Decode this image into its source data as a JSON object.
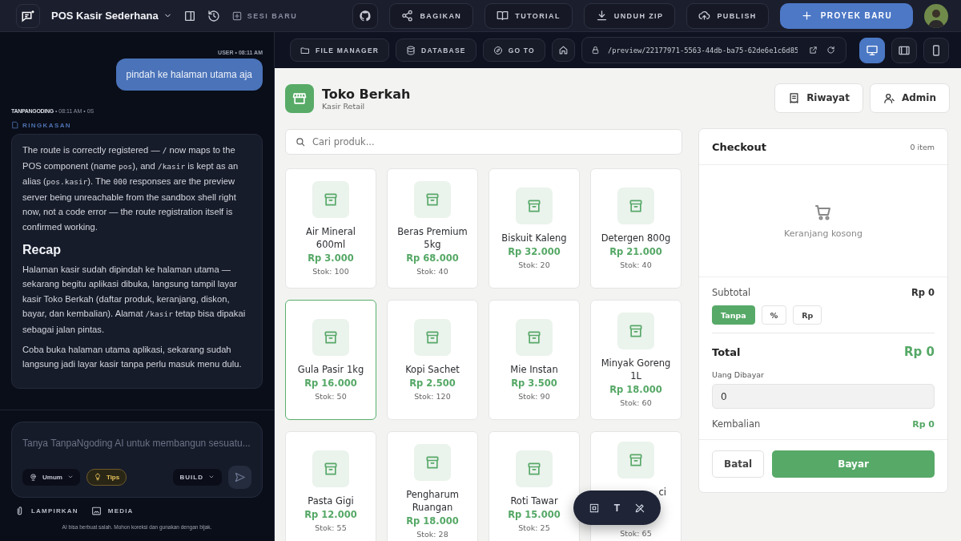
{
  "topbar": {
    "project": "POS Kasir Sederhana",
    "new_session": "SESI BARU",
    "buttons": [
      {
        "label": "BAGIKAN"
      },
      {
        "label": "TUTORIAL"
      },
      {
        "label": "UNDUH ZIP"
      },
      {
        "label": "PUBLISH"
      }
    ],
    "primary": "PROYEK BARU"
  },
  "chat": {
    "messages": [
      {
        "kind": "user",
        "meta": "USER • 08:11 AM",
        "text": "pindah ke halaman utama aja"
      },
      {
        "kind": "assistant",
        "meta_name": "TANPANGODING",
        "meta": "• 08:11 AM • 0S",
        "section": "RINGKASAN",
        "blocks": [
          {
            "kind": "paragraph",
            "segments": [
              {
                "kind": "text",
                "text": "The route is correctly registered — "
              },
              {
                "kind": "code",
                "text": "/"
              },
              {
                "kind": "text",
                "text": " now maps to the POS component (name "
              },
              {
                "kind": "code",
                "text": "pos"
              },
              {
                "kind": "text",
                "text": "), and "
              },
              {
                "kind": "code",
                "text": "/kasir"
              },
              {
                "kind": "text",
                "text": " is kept as an alias ("
              },
              {
                "kind": "code",
                "text": "pos.kasir"
              },
              {
                "kind": "text",
                "text": "). The "
              },
              {
                "kind": "code",
                "text": "000"
              },
              {
                "kind": "text",
                "text": " responses are the preview server being unreachable from the sandbox shell right now, not a code error — the route registration itself is confirmed working."
              }
            ]
          },
          {
            "kind": "heading",
            "segments": [
              {
                "kind": "text",
                "text": "Recap"
              }
            ]
          },
          {
            "kind": "paragraph",
            "segments": [
              {
                "kind": "text",
                "text": "Halaman kasir sudah dipindah ke halaman utama — sekarang begitu aplikasi dibuka, langsung tampil layar kasir Toko Berkah (daftar produk, keranjang, diskon, bayar, dan kembalian). Alamat "
              },
              {
                "kind": "code",
                "text": "/kasir"
              },
              {
                "kind": "text",
                "text": " tetap bisa dipakai sebagai jalan pintas."
              }
            ]
          },
          {
            "kind": "paragraph",
            "segments": [
              {
                "kind": "text",
                "text": "Coba buka halaman utama aplikasi, sekarang sudah langsung jadi layar kasir tanpa perlu masuk menu dulu."
              }
            ]
          }
        ]
      }
    ],
    "input_placeholder": "Tanya TanpaNgoding AI untuk membangun sesuatu...",
    "mode": "Umum",
    "tips": "Tips",
    "build": "BUILD",
    "attach": "LAMPIRKAN",
    "media": "MEDIA",
    "disclaimer": "AI bisa berbuat salah. Mohon koreksi dan gunakan dengan bijak."
  },
  "preview_bar": {
    "buttons": [
      {
        "label": "FILE MANAGER"
      },
      {
        "label": "DATABASE"
      },
      {
        "label": "GO TO"
      }
    ],
    "url": "/preview/22177971-5563-44db-ba75-62de6e1c6d85",
    "devices": [
      {
        "kind": "desktop",
        "selected": true
      },
      {
        "kind": "tablet",
        "selected": false
      },
      {
        "kind": "mobile",
        "selected": false
      }
    ]
  },
  "app": {
    "title": "Toko Berkah",
    "subtitle": "Kasir Retail",
    "header_buttons": [
      {
        "label": "Riwayat"
      },
      {
        "label": "Admin"
      }
    ],
    "search_placeholder": "Cari produk...",
    "products": [
      {
        "name": "Air Mineral 600ml",
        "price": "Rp 3.000",
        "stock": "Stok: 100",
        "selected": false
      },
      {
        "name": "Beras Premium 5kg",
        "price": "Rp 68.000",
        "stock": "Stok: 40",
        "selected": false
      },
      {
        "name": "Biskuit Kaleng",
        "price": "Rp 32.000",
        "stock": "Stok: 20",
        "selected": false
      },
      {
        "name": "Detergen 800g",
        "price": "Rp 21.000",
        "stock": "Stok: 40",
        "selected": false
      },
      {
        "name": "Gula Pasir 1kg",
        "price": "Rp 16.000",
        "stock": "Stok: 50",
        "selected": true
      },
      {
        "name": "Kopi Sachet",
        "price": "Rp 2.500",
        "stock": "Stok: 120",
        "selected": false
      },
      {
        "name": "Mie Instan",
        "price": "Rp 3.500",
        "stock": "Stok: 90",
        "selected": false
      },
      {
        "name": "Minyak Goreng 1L",
        "price": "Rp 18.000",
        "stock": "Stok: 60",
        "selected": false
      },
      {
        "name": "Pasta Gigi",
        "price": "Rp 12.000",
        "stock": "Stok: 55",
        "selected": false
      },
      {
        "name": "Pengharum Ruangan",
        "price": "Rp 18.000",
        "stock": "Stok: 28",
        "selected": false
      },
      {
        "name": "Roti Tawar",
        "price": "Rp 15.000",
        "stock": "Stok: 25",
        "selected": false
      },
      {
        "name": "ci",
        "stock": "Stok: 65",
        "selected": false
      }
    ],
    "checkout": {
      "title": "Checkout",
      "count": "0 item",
      "empty": "Keranjang kosong",
      "subtotal_label": "Subtotal",
      "subtotal": "Rp 0",
      "discount_options": [
        {
          "label": "Tanpa",
          "selected": true
        },
        {
          "label": "%",
          "selected": false
        },
        {
          "label": "Rp",
          "selected": false
        }
      ],
      "total_label": "Total",
      "total": "Rp 0",
      "paid_label": "Uang Dibayar",
      "paid": "0",
      "change_label": "Kembalian",
      "change": "Rp 0",
      "cancel": "Batal",
      "pay": "Bayar"
    }
  },
  "floating_toolbar": {
    "text_tool": "T"
  }
}
